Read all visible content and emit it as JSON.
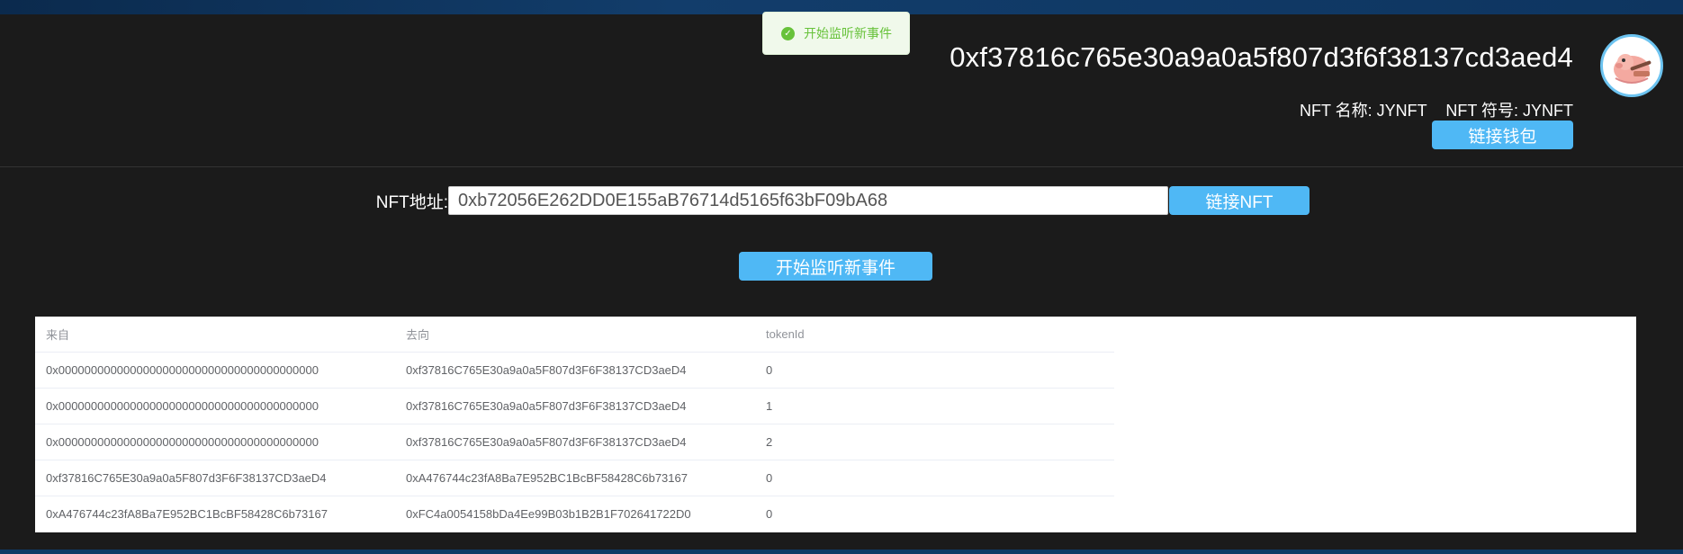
{
  "header": {
    "account_address": "0xf37816c765e30a9a0a5f807d3f6f38137cd3aed4",
    "nft_name": "NFT 名称: JYNFT",
    "nft_symbol": "NFT 符号: JYNFT",
    "connect_wallet_label": "链接钱包",
    "avatar_icon": "cartoon-avatar-icon"
  },
  "toast": {
    "message": "开始监听新事件",
    "icon": "success-check-icon",
    "color": "#67c23a"
  },
  "nft_form": {
    "label": "NFT地址:",
    "address_value": "0xb72056E262DD0E155aB76714d5165f63bF09bA68",
    "connect_nft_label": "链接NFT"
  },
  "listen_button_label": "开始监听新事件",
  "accent_color": "#4fb8f5",
  "table": {
    "headers": [
      "来自",
      "去向",
      "tokenId"
    ],
    "rows": [
      [
        "0x0000000000000000000000000000000000000000",
        "0xf37816C765E30a9a0a5F807d3F6F38137CD3aeD4",
        "0"
      ],
      [
        "0x0000000000000000000000000000000000000000",
        "0xf37816C765E30a9a0a5F807d3F6F38137CD3aeD4",
        "1"
      ],
      [
        "0x0000000000000000000000000000000000000000",
        "0xf37816C765E30a9a0a5F807d3F6F38137CD3aeD4",
        "2"
      ],
      [
        "0xf37816C765E30a9a0a5F807d3F6F38137CD3aeD4",
        "0xA476744c23fA8Ba7E952BC1BcBF58428C6b73167",
        "0"
      ],
      [
        "0xA476744c23fA8Ba7E952BC1BcBF58428C6b73167",
        "0xFC4a0054158bDa4Ee99B03b1B2B1F702641722D0",
        "0"
      ]
    ]
  }
}
